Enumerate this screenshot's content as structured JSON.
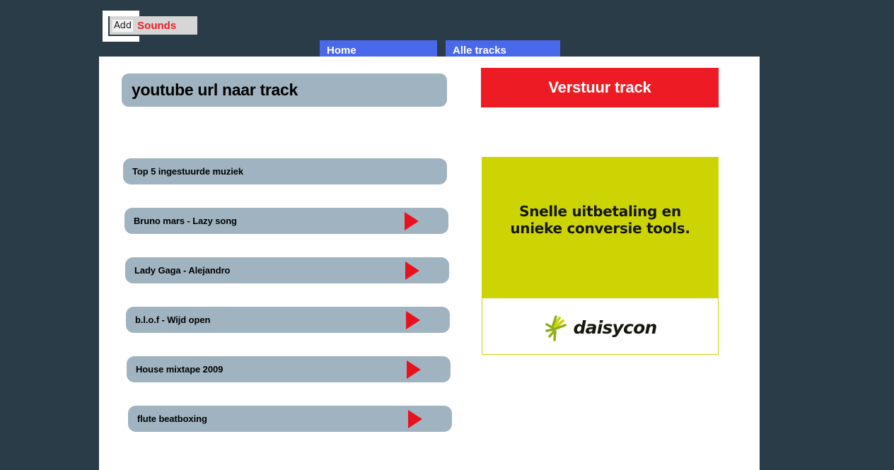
{
  "brand": {
    "prefix": "Add",
    "suffix": "Sounds",
    "suffix_color": "#ee1c25"
  },
  "nav": {
    "items": [
      {
        "label": "Home"
      },
      {
        "label": "Alle tracks"
      }
    ],
    "accent_color": "#4a68ea"
  },
  "main": {
    "heading": "youtube url naar track",
    "submit_label": "Verstuur track",
    "submit_color": "#ed1c24",
    "bar_color": "#9fb4c0",
    "play_color": "#e8121f",
    "tracks": [
      {
        "title": "Top 5 ingestuurde muziek",
        "has_play": false
      },
      {
        "title": "Bruno mars - Lazy song",
        "has_play": true
      },
      {
        "title": "Lady Gaga - Alejandro",
        "has_play": true
      },
      {
        "title": "b.l.o.f - Wijd open",
        "has_play": true
      },
      {
        "title": "House mixtape 2009",
        "has_play": true
      },
      {
        "title": "flute beatboxing",
        "has_play": true
      }
    ]
  },
  "ad": {
    "headline_line1": "Snelle uitbetaling en",
    "headline_line2": "unieke conversie tools.",
    "advertiser": "daisycon",
    "bg_color": "#cdd404"
  },
  "page_background": "#2a3c47"
}
